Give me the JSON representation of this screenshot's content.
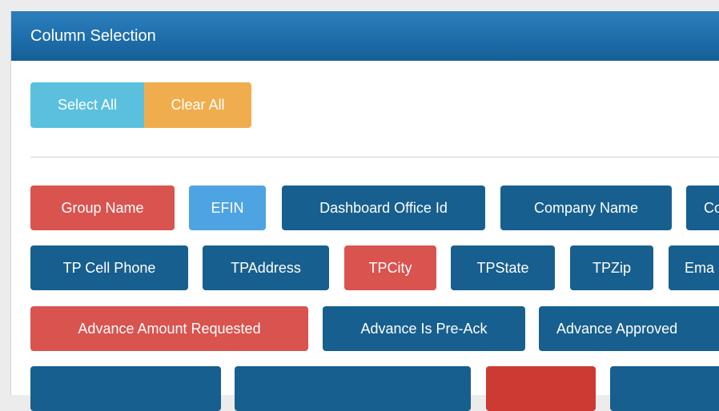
{
  "panel": {
    "title": "Column Selection"
  },
  "actions": {
    "select_all": "Select All",
    "clear_all": "Clear All"
  },
  "columns": [
    {
      "label": "Group Name",
      "state": "selected-red"
    },
    {
      "label": "EFIN",
      "state": "selected-blue"
    },
    {
      "label": "Dashboard Office Id",
      "state": "default"
    },
    {
      "label": "Company Name",
      "state": "default"
    },
    {
      "label": "Co",
      "state": "default"
    },
    {
      "label": "TP Cell Phone",
      "state": "default"
    },
    {
      "label": "TPAddress",
      "state": "default"
    },
    {
      "label": "TPCity",
      "state": "selected-red"
    },
    {
      "label": "TPState",
      "state": "default"
    },
    {
      "label": "TPZip",
      "state": "default"
    },
    {
      "label": "Ema",
      "state": "default"
    },
    {
      "label": "Advance Amount Requested",
      "state": "selected-red"
    },
    {
      "label": "Advance Is Pre-Ack",
      "state": "default"
    },
    {
      "label": "Advance Approved",
      "state": "default"
    },
    {
      "label": "",
      "state": "default"
    },
    {
      "label": "",
      "state": "default"
    },
    {
      "label": "",
      "state": "selected-crimson"
    },
    {
      "label": "",
      "state": "default"
    }
  ],
  "colors": {
    "header": "#1d6ca8",
    "select_all": "#5bc0de",
    "clear_all": "#f0ad4e",
    "chip_default": "#175f8e",
    "chip_red": "#d9534f",
    "chip_blue": "#4ea3e2",
    "chip_crimson": "#cc3a33"
  }
}
